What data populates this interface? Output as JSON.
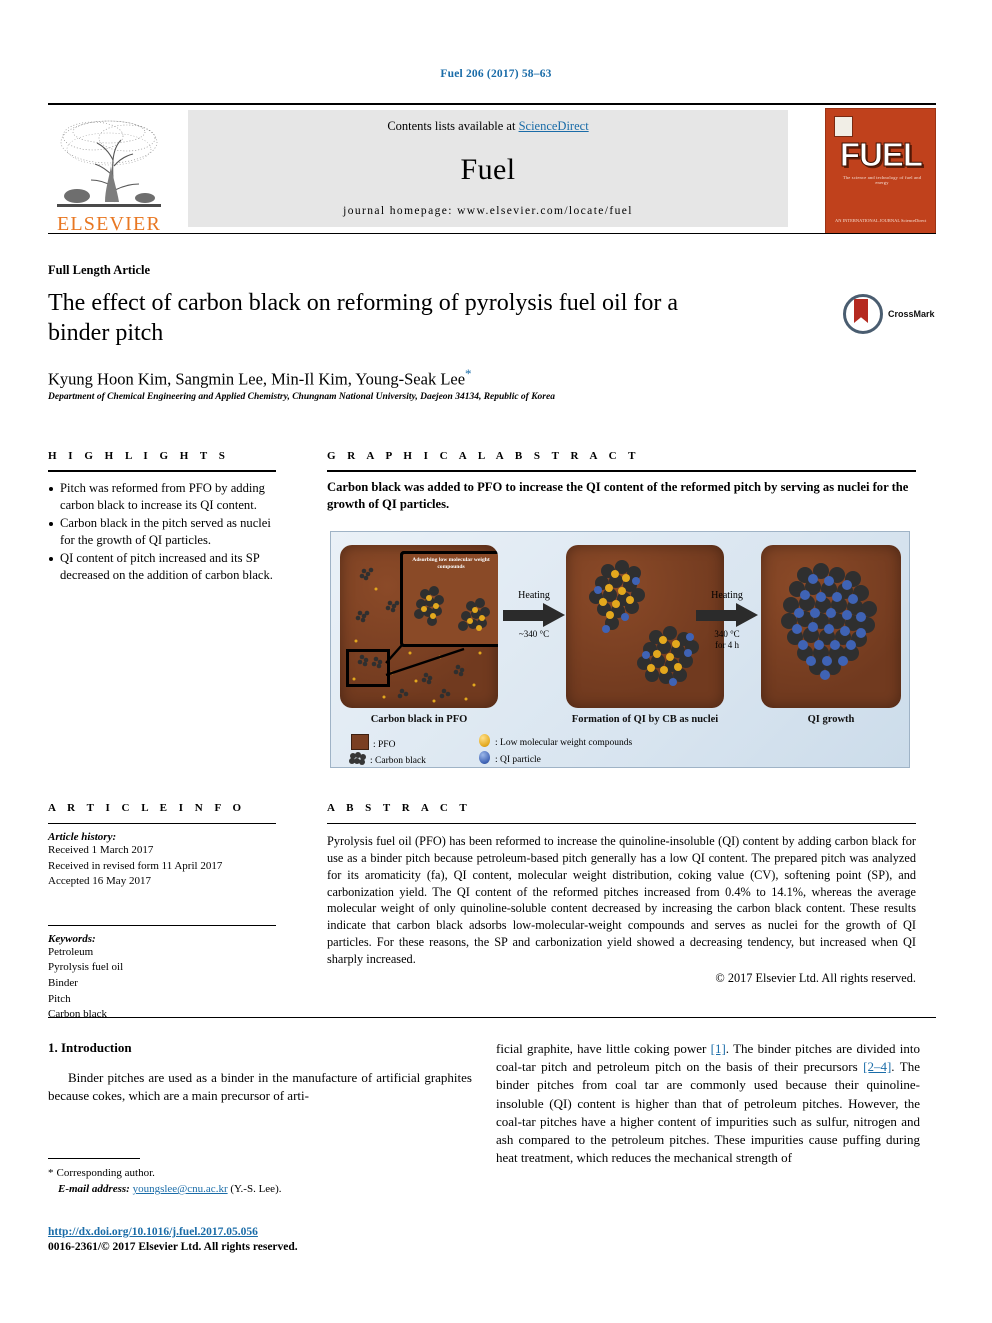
{
  "running_head": "Fuel 206 (2017) 58–63",
  "masthead": {
    "contents_prefix": "Contents lists available at ",
    "contents_link": "ScienceDirect",
    "journal_name": "Fuel",
    "homepage": "journal homepage: www.elsevier.com/locate/fuel",
    "publisher_wordmark": "ELSEVIER",
    "cover": {
      "wordmark": "FUEL",
      "subtitle": "The science and technology of fuel and energy",
      "footer": "AN INTERNATIONAL JOURNAL\nScienceDirect"
    }
  },
  "article": {
    "type": "Full Length Article",
    "title": "The effect of carbon black on reforming of pyrolysis fuel oil for a binder pitch",
    "authors": "Kyung Hoon Kim, Sangmin Lee, Min-Il Kim, Young-Seak Lee",
    "corresponding_marker": "*",
    "affiliation": "Department of Chemical Engineering and Applied Chemistry, Chungnam National University, Daejeon 34134, Republic of Korea",
    "crossmark_label": "CrossMark"
  },
  "highlights": {
    "heading": "H I G H L I G H T S",
    "items": [
      "Pitch was reformed from PFO by adding carbon black to increase its QI content.",
      "Carbon black in the pitch served as nuclei for the growth of QI particles.",
      "QI content of pitch increased and its SP decreased on the addition of carbon black."
    ]
  },
  "graphical_abstract": {
    "heading": "G R A P H I C A L   A B S T R A C T",
    "description": "Carbon black was added to PFO to increase the QI content of the reformed pitch by serving as nuclei for the growth of QI particles.",
    "figure": {
      "inset_label": "Adsorbing low molecular weight compounds",
      "panel_captions": [
        "Carbon black in PFO",
        "Formation of QI by CB as nuclei",
        "QI growth"
      ],
      "arrows": [
        {
          "label": "Heating",
          "condition": "~340 °C"
        },
        {
          "label": "Heating",
          "condition": "340 °C\nfor 4 h"
        }
      ],
      "arrow1_label": "Heating",
      "arrow1_condition": "~340 °C",
      "arrow2_label": "Heating",
      "arrow2_condition_line1": "340 °C",
      "arrow2_condition_line2": "for 4 h",
      "legend": [
        {
          "key": "pfo-swatch",
          "label": ": PFO"
        },
        {
          "key": "carbon-black-swatch",
          "label": ": Carbon black"
        },
        {
          "key": "low-mw-dot",
          "label": ": Low molecular weight compounds"
        },
        {
          "key": "qi-dot",
          "label": ": QI particle"
        }
      ],
      "colors": {
        "pfo_brown": "#7a3f22",
        "carbon_black": "#3a3a3a",
        "low_mw_yellow": "#e3a81d",
        "qi_blue": "#3f63b5",
        "background": "#dfe9f3"
      }
    }
  },
  "article_info": {
    "heading": "A R T I C L E   I N F O",
    "history_label": "Article history:",
    "history": [
      "Received 1 March 2017",
      "Received in revised form 11 April 2017",
      "Accepted 16 May 2017"
    ],
    "keywords_label": "Keywords:",
    "keywords": [
      "Petroleum",
      "Pyrolysis fuel oil",
      "Binder",
      "Pitch",
      "Carbon black"
    ]
  },
  "abstract": {
    "heading": "A B S T R A C T",
    "body": "Pyrolysis fuel oil (PFO) has been reformed to increase the quinoline-insoluble (QI) content by adding carbon black for use as a binder pitch because petroleum-based pitch generally has a low QI content. The prepared pitch was analyzed for its aromaticity (fa), QI content, molecular weight distribution, coking value (CV), softening point (SP), and carbonization yield. The QI content of the reformed pitches increased from 0.4% to 14.1%, whereas the average molecular weight of only quinoline-soluble content decreased by increasing the carbon black content. These results indicate that carbon black adsorbs low-molecular-weight compounds and serves as nuclei for the growth of QI particles. For these reasons, the SP and carbonization yield showed a decreasing tendency, but increased when QI sharply increased.",
    "copyright": "© 2017 Elsevier Ltd. All rights reserved."
  },
  "body": {
    "section_heading": "1. Introduction",
    "left_paragraph": "Binder pitches are used as a binder in the manufacture of artificial graphites because cokes, which are a main precursor of arti-",
    "right_paragraph_part1": "ficial graphite, have little coking power ",
    "right_ref1": "[1]",
    "right_paragraph_part2": ". The binder pitches are divided into coal-tar pitch and petroleum pitch on the basis of their precursors ",
    "right_ref2": "[2–4]",
    "right_paragraph_part3": ". The binder pitches from coal tar are commonly used because their quinoline-insoluble (QI) content is higher than that of petroleum pitches. However, the coal-tar pitches have a higher content of impurities such as sulfur, nitrogen and ash compared to the petroleum pitches. These impurities cause puffing during heat treatment, which reduces the mechanical strength of"
  },
  "footnotes": {
    "corresponding_star": "*",
    "corresponding_text": "Corresponding author.",
    "email_label": "E-mail address:",
    "email": "youngslee@cnu.ac.kr",
    "email_suffix": "(Y.-S. Lee)."
  },
  "doc_footer": {
    "doi": "http://dx.doi.org/10.1016/j.fuel.2017.05.056",
    "issn_line": "0016-2361/© 2017 Elsevier Ltd. All rights reserved."
  }
}
